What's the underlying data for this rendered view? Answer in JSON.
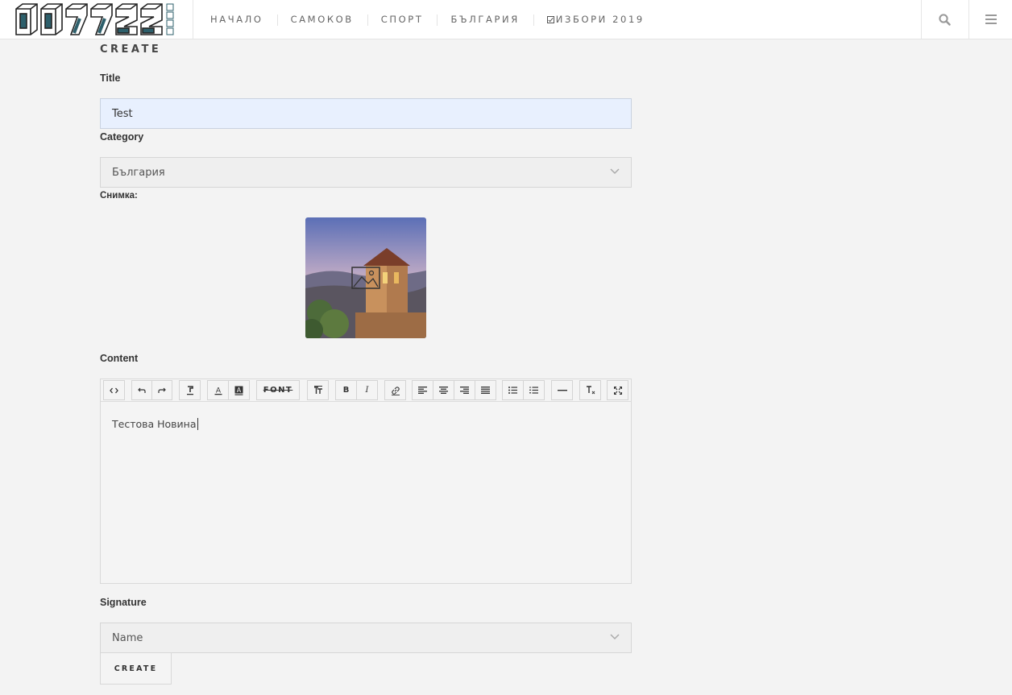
{
  "header": {
    "logo_alt": "007222 news",
    "nav": [
      {
        "label": "НАЧАЛО"
      },
      {
        "label": "САМОКОВ"
      },
      {
        "label": "СПОРТ"
      },
      {
        "label": "БЪЛГАРИЯ"
      },
      {
        "label": "ИЗБОРИ 2019",
        "icon": "checkbox-icon"
      }
    ],
    "icons": [
      "search-icon",
      "hamburger-menu-icon"
    ]
  },
  "form": {
    "page_title": "CREATE",
    "title_label": "Title",
    "title_value": "Test",
    "category_label": "Category",
    "category_value": "България",
    "photo_label": "Снимка:",
    "content_label": "Content",
    "content_value": "Тестова Новина",
    "toolbar": {
      "font_label": "FONT",
      "bold_label": "B",
      "italic_label": "I"
    },
    "signature_label": "Signature",
    "signature_value": "Name",
    "submit_label": "CREATE"
  },
  "colors": {
    "logo_accent": "#2d5f6b",
    "title_input_bg": "#e8f0fe",
    "page_bg": "#f3f3f3"
  }
}
